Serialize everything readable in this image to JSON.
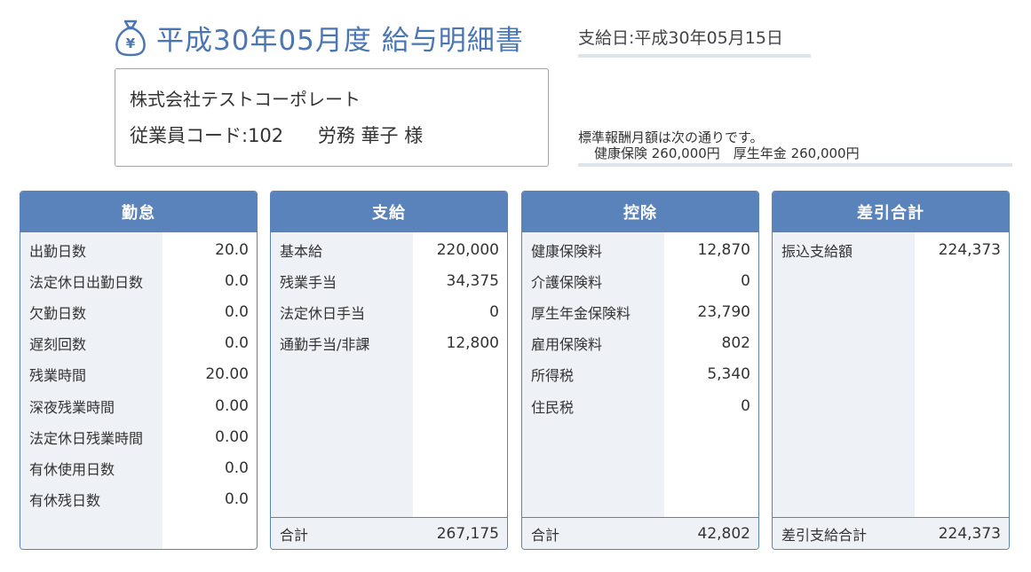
{
  "header": {
    "icon": "money-bag-icon",
    "title": "平成30年05月度 給与明細書",
    "payday": "支給日:平成30年05月15日"
  },
  "company": {
    "name": "株式会社テストコーポレート",
    "employee_code": "従業員コード:102",
    "employee_name": "労務 華子 様"
  },
  "standard_remuneration": {
    "note": "標準報酬月額は次の通りです。",
    "detail": "健康保険 260,000円　厚生年金 260,000円"
  },
  "attendance": {
    "title": "勤怠",
    "rows": [
      {
        "label": "出勤日数",
        "value": "20.0"
      },
      {
        "label": "法定休日出勤日数",
        "value": "0.0"
      },
      {
        "label": "欠勤日数",
        "value": "0.0"
      },
      {
        "label": "遅刻回数",
        "value": "0.0"
      },
      {
        "label": "残業時間",
        "value": "20.00"
      },
      {
        "label": "深夜残業時間",
        "value": "0.00"
      },
      {
        "label": "法定休日残業時間",
        "value": "0.00"
      },
      {
        "label": "有休使用日数",
        "value": "0.0"
      },
      {
        "label": "有休残日数",
        "value": "0.0"
      }
    ]
  },
  "payment": {
    "title": "支給",
    "rows": [
      {
        "label": "基本給",
        "value": "220,000"
      },
      {
        "label": "残業手当",
        "value": "34,375"
      },
      {
        "label": "法定休日手当",
        "value": "0"
      },
      {
        "label": "通勤手当/非課",
        "value": "12,800"
      }
    ],
    "total_label": "合計",
    "total_value": "267,175"
  },
  "deduction": {
    "title": "控除",
    "rows": [
      {
        "label": "健康保険料",
        "value": "12,870"
      },
      {
        "label": "介護保険料",
        "value": "0"
      },
      {
        "label": "厚生年金保険料",
        "value": "23,790"
      },
      {
        "label": "雇用保険料",
        "value": "802"
      },
      {
        "label": "所得税",
        "value": "5,340"
      },
      {
        "label": "住民税",
        "value": "0"
      }
    ],
    "total_label": "合計",
    "total_value": "42,802"
  },
  "net": {
    "title": "差引合計",
    "rows": [
      {
        "label": "振込支給額",
        "value": "224,373"
      }
    ],
    "total_label": "差引支給合計",
    "total_value": "224,373"
  },
  "colors": {
    "accent": "#5b83bb",
    "title_text": "#4a76b3",
    "label_bg": "#eef1f6"
  }
}
